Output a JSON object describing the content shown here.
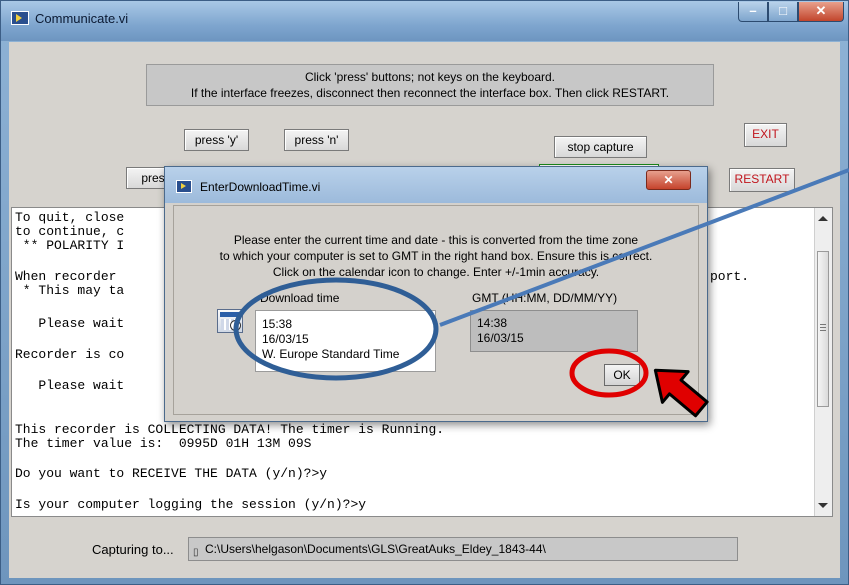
{
  "window": {
    "title": "Communicate.vi",
    "controls": {
      "minimize": "–",
      "maximize": "□",
      "close": "✕"
    }
  },
  "banner": {
    "line1": "Click 'press' buttons; not keys on the keyboard.",
    "line2": "If the interface freezes, disconnect then reconnect the interface box. Then click RESTART."
  },
  "buttons": {
    "press_y": "press 'y'",
    "press_n": "press 'n'",
    "press_other": "press",
    "stop_capture": "stop capture",
    "exit": "EXIT",
    "restart": "RESTART"
  },
  "terminal": {
    "lines": [
      "To quit, close",
      "to continue, c",
      " ** POLARITY I",
      "",
      "When recorder",
      " * This may ta",
      "",
      "   Please wait",
      "",
      "Recorder is co",
      "",
      "   Please wait",
      "",
      "",
      "This recorder is COLLECTING DATA! The timer is Running.",
      "The timer value is:  0995D 01H 13M 09S",
      "",
      "Do you want to RECEIVE THE DATA (y/n)?>y",
      "",
      "Is your computer logging the session (y/n)?>y"
    ],
    "right_fragment": "port."
  },
  "capture": {
    "label": "Capturing to...",
    "path": "C:\\Users\\helgason\\Documents\\GLS\\GreatAuks_Eldey_1843-44\\"
  },
  "dialog": {
    "title": "EnterDownloadTime.vi",
    "close": "✕",
    "message_line1": "Please enter the current time and date - this is converted from the time zone",
    "message_line2": "to which your computer is set to GMT in the right hand box. Ensure this is correct.",
    "message_line3": "Click on the calendar icon to change. Enter +/-1min accuracy.",
    "download_label": "Download time",
    "download_time": "15:38",
    "download_date": "16/03/15",
    "download_zone": "W. Europe Standard Time",
    "gmt_label": "GMT (HH:MM, DD/MM/YY)",
    "gmt_time": "14:38",
    "gmt_date": "16/03/15",
    "ok": "OK"
  },
  "colors": {
    "accent_red": "#e00000",
    "ellipse_blue": "#2f5e96",
    "pointer_line": "#4a7ab8",
    "button_green": "#28b82a"
  }
}
